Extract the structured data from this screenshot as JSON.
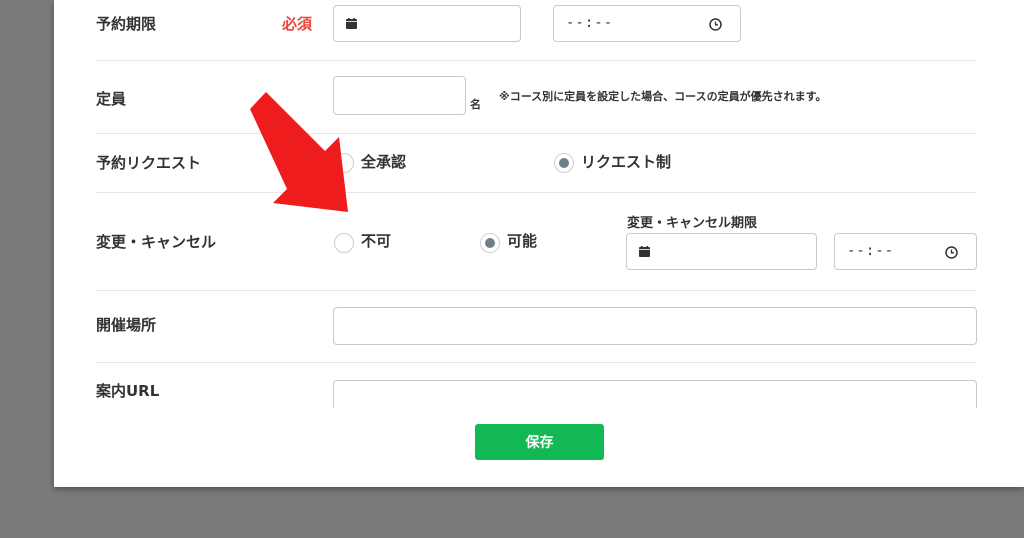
{
  "form": {
    "deadline": {
      "label": "予約期限",
      "required": "必須",
      "time_placeholder": "--:--"
    },
    "capacity": {
      "label": "定員",
      "unit": "名",
      "note": "※コース別に定員を設定した場合、コースの定員が優先されます。"
    },
    "request": {
      "label": "予約リクエスト",
      "options": [
        "全承認",
        "リクエスト制"
      ],
      "selected": "リクエスト制"
    },
    "change_cancel": {
      "label": "変更・キャンセル",
      "options": [
        "不可",
        "可能"
      ],
      "selected": "可能",
      "deadline_label": "変更・キャンセル期限",
      "time_placeholder": "--:--"
    },
    "venue": {
      "label": "開催場所"
    },
    "guide_url": {
      "label": "案内URL"
    },
    "save_label": "保存"
  },
  "colors": {
    "required": "#e8473c",
    "save_button": "#12b853",
    "arrow": "#ee1c1c",
    "radio_checked": "#6f7f86"
  },
  "icons": [
    "calendar-icon",
    "clock-icon",
    "arrow-annotation"
  ]
}
